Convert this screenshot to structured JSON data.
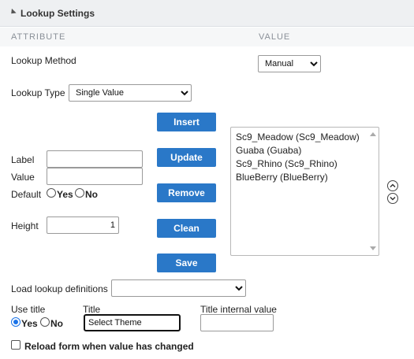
{
  "panel": {
    "title": "Lookup Settings"
  },
  "columns": {
    "attribute": "ATTRIBUTE",
    "value": "VALUE"
  },
  "lookup_method": {
    "label": "Lookup Method",
    "value": "Manual"
  },
  "lookup_type": {
    "label": "Lookup Type",
    "value": "Single Value"
  },
  "buttons": {
    "insert": "Insert",
    "update": "Update",
    "remove": "Remove",
    "clean": "Clean",
    "save": "Save"
  },
  "fields": {
    "label": {
      "label": "Label",
      "value": ""
    },
    "value": {
      "label": "Value",
      "value": ""
    },
    "default": {
      "label": "Default",
      "yes": "Yes",
      "no": "No"
    },
    "height": {
      "label": "Height",
      "value": "1"
    }
  },
  "list": {
    "items": [
      "Sc9_Meadow (Sc9_Meadow)",
      "Guaba (Guaba)",
      "Sc9_Rhino (Sc9_Rhino)",
      "BlueBerry (BlueBerry)"
    ]
  },
  "load_defs": {
    "label": "Load lookup definitions",
    "value": ""
  },
  "use_title": {
    "label": "Use title",
    "yes": "Yes",
    "no": "No",
    "selected": "Yes"
  },
  "title": {
    "label": "Title",
    "value": "Select Theme"
  },
  "title_internal": {
    "label": "Title internal value",
    "value": ""
  },
  "reload": {
    "label": "Reload form when value has changed",
    "checked": false
  },
  "colors": {
    "accent": "#2a78c8",
    "header_bg": "#eef0f2"
  }
}
